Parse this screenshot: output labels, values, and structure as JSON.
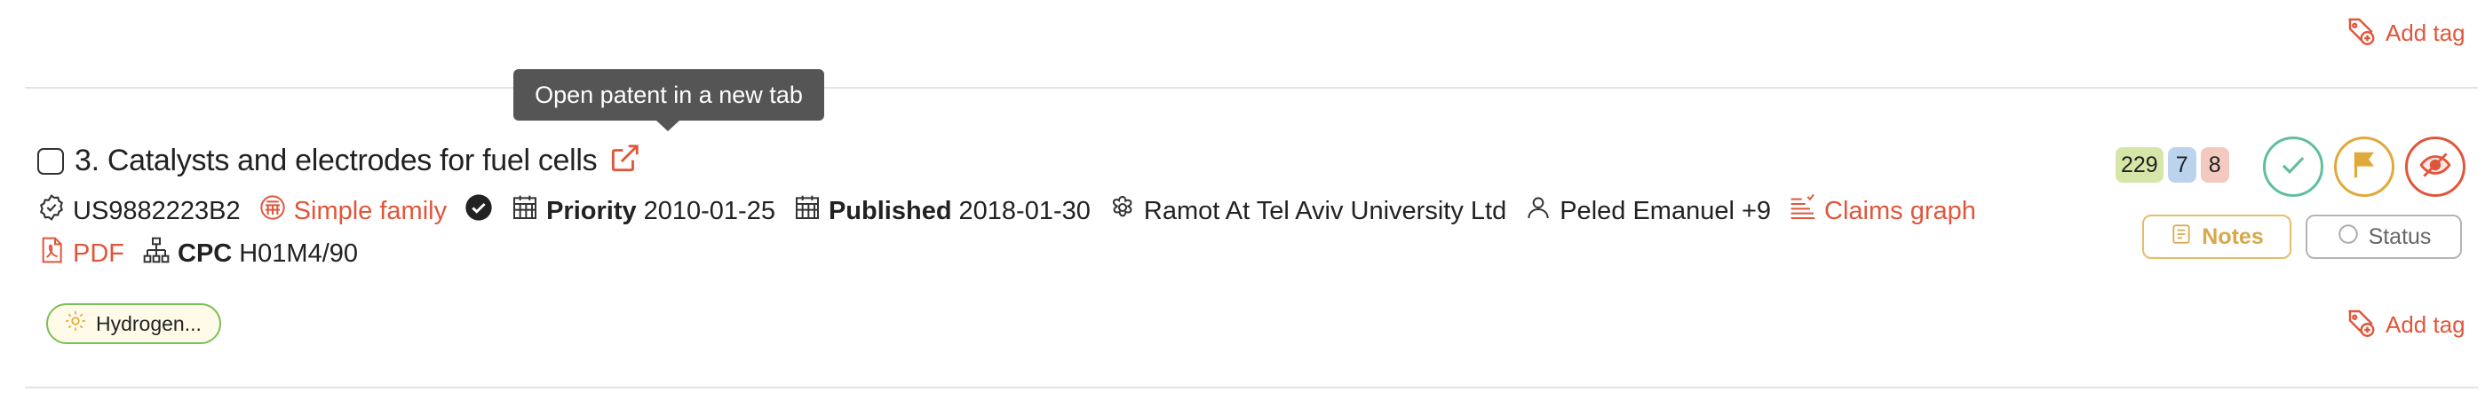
{
  "top_add_tag": {
    "label": "Add tag",
    "icon": "tag-plus-icon"
  },
  "tooltip": {
    "text": "Open patent in a new tab"
  },
  "patent": {
    "title": "3. Catalysts and electrodes for fuel cells",
    "number": "US9882223B2",
    "family_label": "Simple family",
    "priority_label": "Priority",
    "priority_date": "2010-01-25",
    "published_label": "Published",
    "published_date": "2018-01-30",
    "assignee": "Ramot At Tel Aviv University Ltd",
    "inventor": "Peled Emanuel +9",
    "claims_graph_label": "Claims graph",
    "pdf_label": "PDF",
    "cpc_label": "CPC",
    "cpc_value": "H01M4/90",
    "tag_chip": "Hydrogen..."
  },
  "counts": [
    {
      "value": "229",
      "color": "#d6e6a8"
    },
    {
      "value": "7",
      "color": "#bcd3ee"
    },
    {
      "value": "8",
      "color": "#f4c9bf"
    }
  ],
  "actions": {
    "notes_label": "Notes",
    "status_label": "Status",
    "colors": {
      "approve": "#5fbf9a",
      "flag": "#e0a93a",
      "hide": "#e0563b",
      "notes": "#d9a84a",
      "status": "#9a9a9a"
    }
  },
  "bottom_add_tag": {
    "label": "Add tag",
    "icon": "tag-plus-icon"
  },
  "colors": {
    "accent": "#e0563b",
    "tooltip_bg": "#555555",
    "chip_border": "#7cc05a"
  }
}
